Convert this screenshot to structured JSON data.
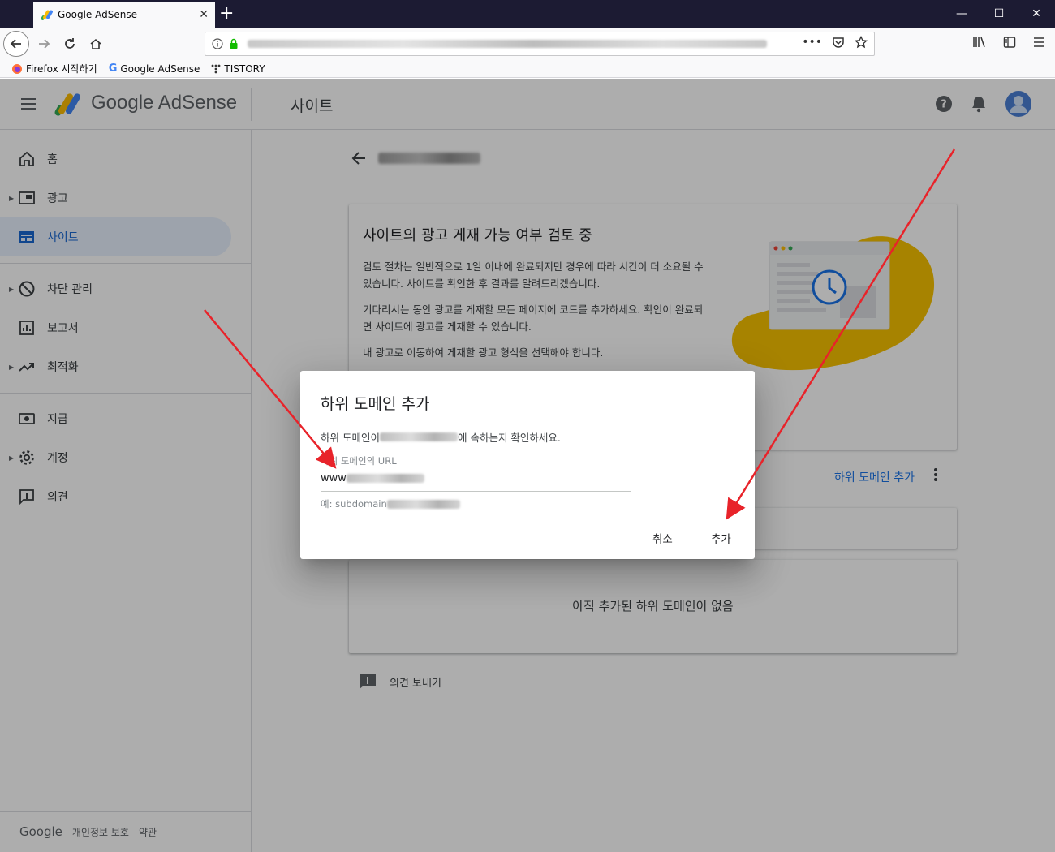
{
  "browser": {
    "tab_title": "Google AdSense",
    "tab_close": "✕",
    "new_tab": "+",
    "window_controls": [
      "—",
      "☐",
      "✕"
    ],
    "bookmarks": [
      {
        "label": "Firefox 시작하기",
        "icon": "firefox-icon"
      },
      {
        "label": "Google AdSense",
        "icon": "google-g-icon"
      },
      {
        "label": "TISTORY",
        "icon": "tistory-icon"
      }
    ]
  },
  "header": {
    "brand": "Google AdSense",
    "page_title": "사이트",
    "help_icon": "help-icon",
    "bell_icon": "notifications-icon",
    "avatar_icon": "account-avatar"
  },
  "sidebar": {
    "items": [
      {
        "label": "홈",
        "icon": "home-icon",
        "expandable": false,
        "active": false
      },
      {
        "label": "광고",
        "icon": "ads-icon",
        "expandable": true,
        "active": false
      },
      {
        "label": "사이트",
        "icon": "sites-icon",
        "expandable": false,
        "active": true
      },
      {
        "label": "차단 관리",
        "icon": "block-icon",
        "expandable": true,
        "active": false
      },
      {
        "label": "보고서",
        "icon": "reports-icon",
        "expandable": false,
        "active": false
      },
      {
        "label": "최적화",
        "icon": "trending-icon",
        "expandable": true,
        "active": false
      },
      {
        "label": "지급",
        "icon": "payments-icon",
        "expandable": false,
        "active": false
      },
      {
        "label": "계정",
        "icon": "settings-icon",
        "expandable": true,
        "active": false
      },
      {
        "label": "의견",
        "icon": "feedback-icon",
        "expandable": false,
        "active": false
      }
    ],
    "footer": {
      "google": "Google",
      "privacy": "개인정보 보호",
      "terms": "약관"
    }
  },
  "main": {
    "review_card": {
      "title": "사이트의 광고 게재 가능 여부 검토 중",
      "paragraphs": [
        "검토 절차는 일반적으로 1일 이내에 완료되지만 경우에 따라 시간이 더 소요될 수 있습니다. 사이트를 확인한 후 결과를 알려드리겠습니다.",
        "기다리시는 동안 광고를 게재할 모든 페이지에 코드를 추가하세요. 확인이 완료되면 사이트에 광고를 게재할 수 있습니다.",
        "내 광고로 이동하여 게재할 광고 형식을 선택해야 합니다."
      ]
    },
    "add_subdomain_link": "하위 도메인 추가",
    "empty_subdomains": "아직 추가된 하위 도메인이 없음",
    "send_feedback": "의견 보내기",
    "colors": {
      "accent": "#1a73e8",
      "illustration_blob": "#f7c100",
      "active_bg": "#e8f0fe"
    }
  },
  "dialog": {
    "title": "하위 도메인 추가",
    "desc_prefix": "하위 도메인이 ",
    "desc_suffix": "에 속하는지 확인하세요.",
    "field_label": "하위 도메인의 URL",
    "field_value_prefix": "www",
    "hint_prefix": "예: subdomain",
    "cancel": "취소",
    "add": "추가"
  },
  "annotations": {
    "arrow_color": "#e8232a"
  }
}
